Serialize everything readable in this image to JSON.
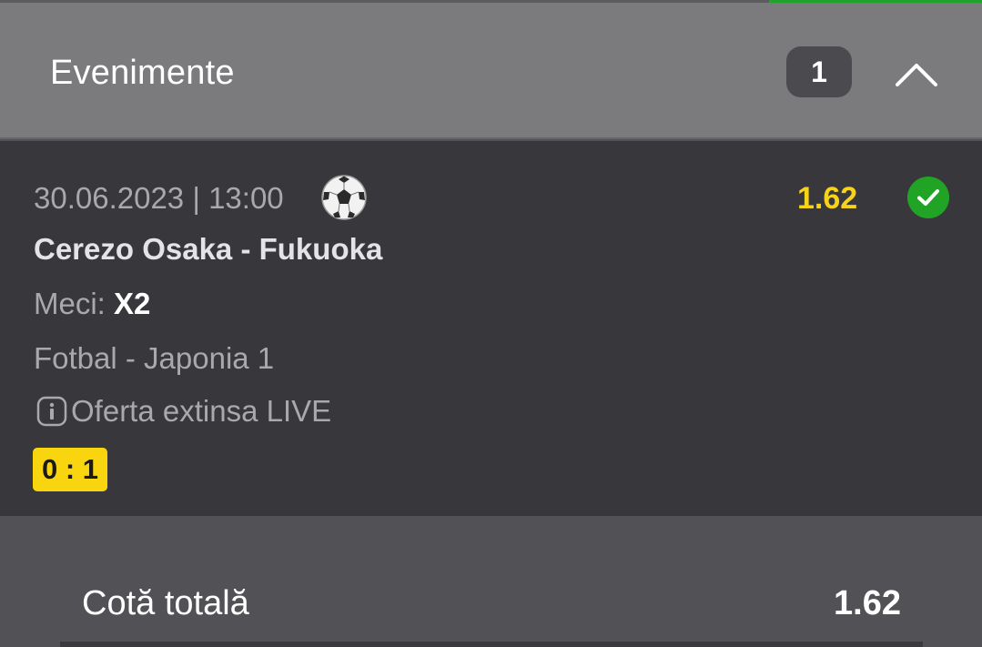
{
  "header": {
    "title": "Evenimente",
    "count": "1",
    "collapse_icon": "chevron-up-icon"
  },
  "event": {
    "datetime": "30.06.2023 | 13:00",
    "sport_icon": "soccer-ball-icon",
    "odd": "1.62",
    "status_icon": "check-circle-icon",
    "teams": "Cerezo Osaka - Fukuoka",
    "market_label": "Meci:",
    "market_pick": "X2",
    "league": "Fotbal - Japonia 1",
    "info_icon": "info-icon",
    "offer_text": "Oferta extinsa LIVE",
    "score": "0 : 1"
  },
  "totals": {
    "label": "Cotă totală",
    "value": "1.62"
  },
  "colors": {
    "accent_green": "#1fa32a",
    "odd_yellow": "#f7d21a",
    "score_yellow": "#f8d50f",
    "header_bg": "#7b7b7d",
    "event_bg": "#38383c"
  }
}
